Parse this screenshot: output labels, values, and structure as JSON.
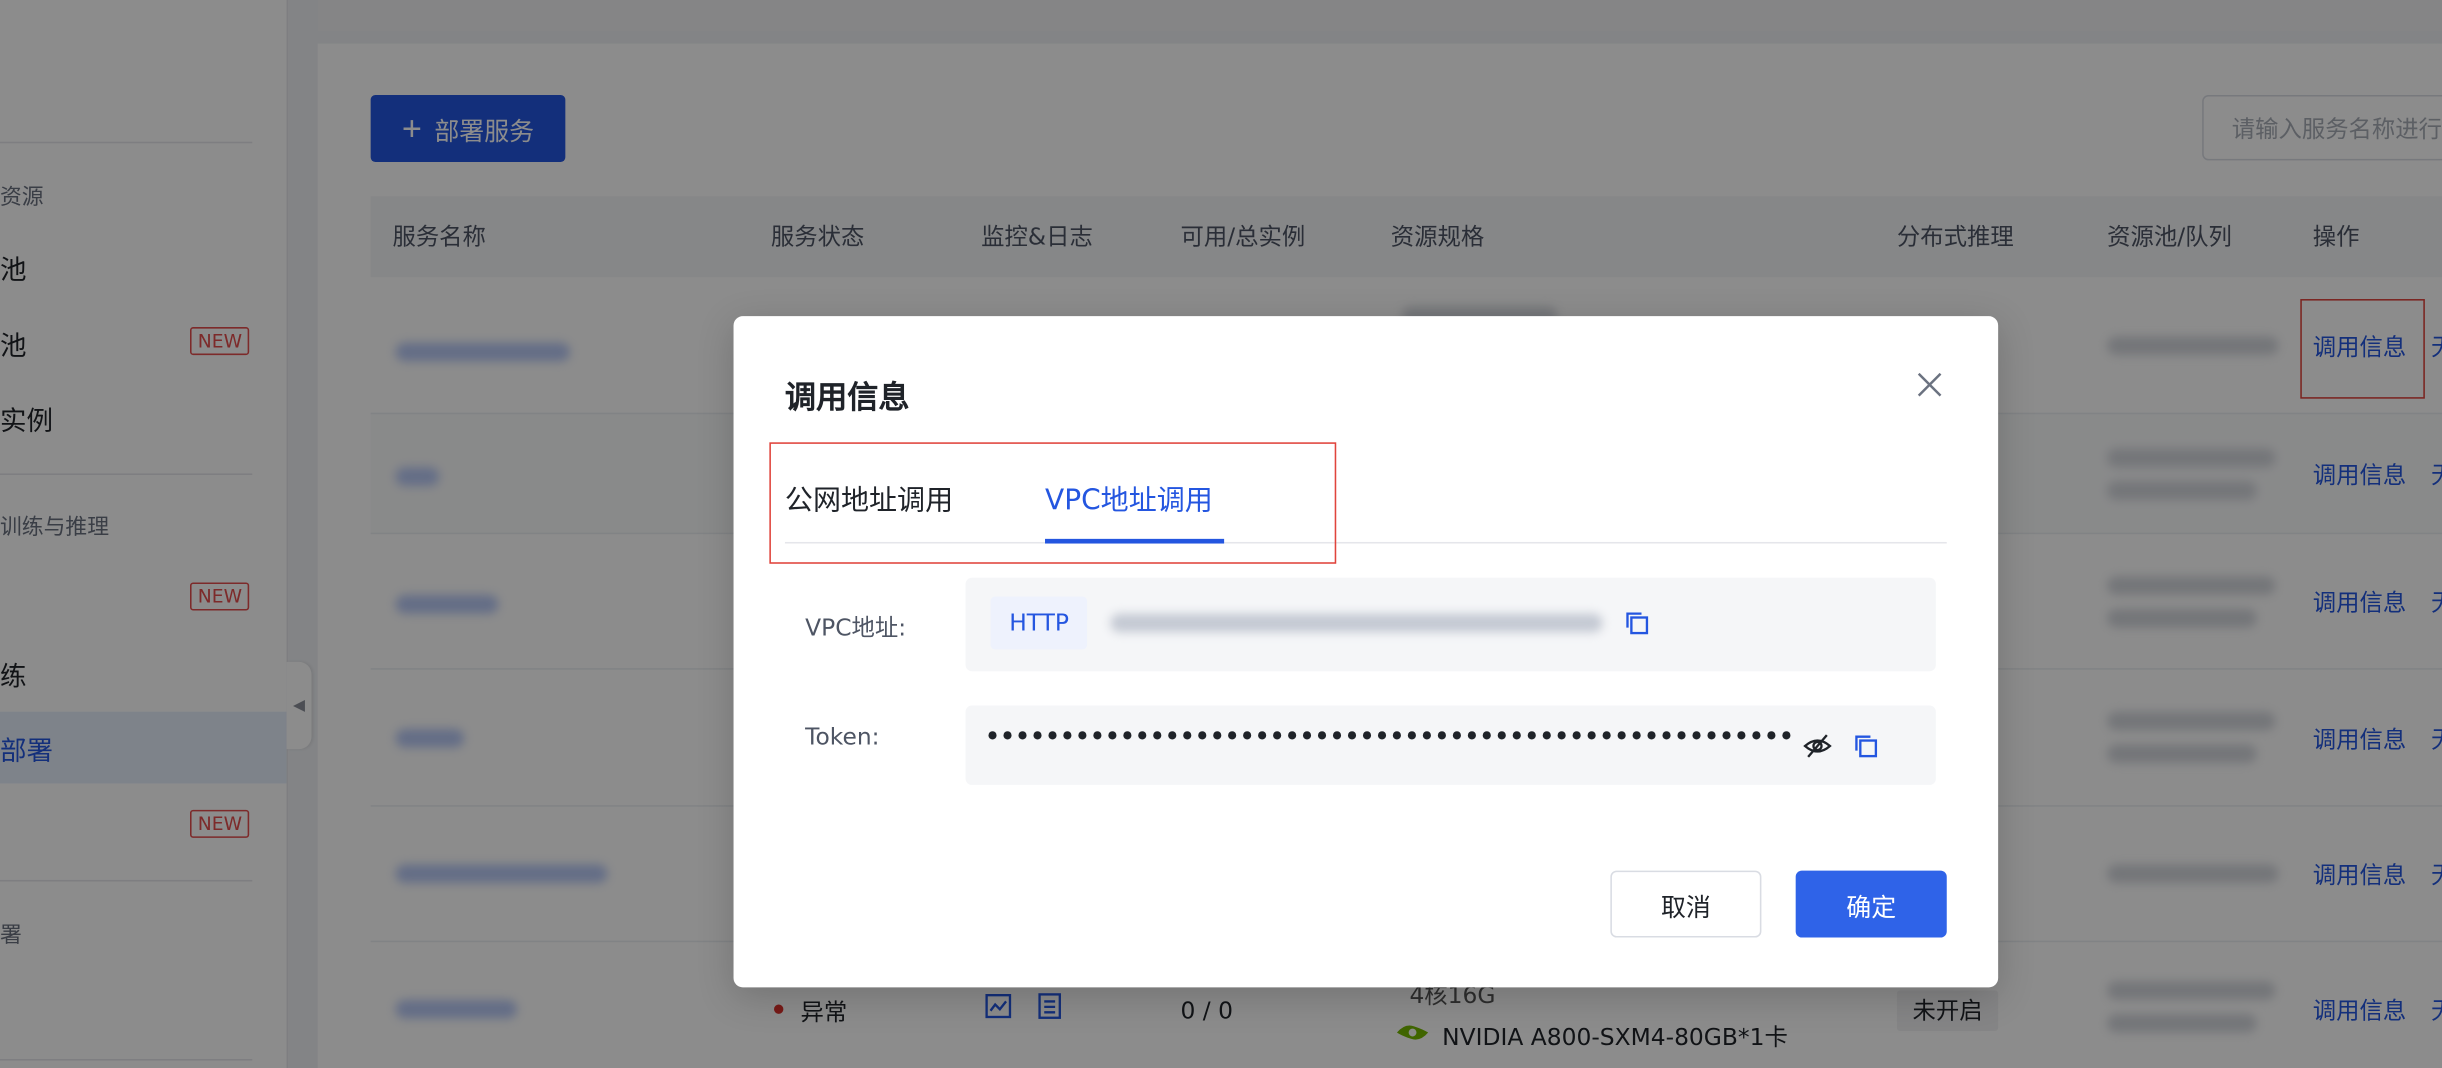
{
  "sidebar": {
    "groups": [
      "资源",
      "训练与推理",
      "署"
    ],
    "items": [
      "池",
      "池",
      "实例",
      "练",
      "部署"
    ],
    "new_badge": "NEW"
  },
  "toolbar": {
    "deploy_label": "部署服务",
    "search_placeholder": "请输入服务名称进行"
  },
  "table": {
    "columns": [
      "服务名称",
      "服务状态",
      "监控&日志",
      "可用/总实例",
      "资源规格",
      "分布式推理",
      "资源池/队列",
      "操作"
    ],
    "op_link": "调用信息",
    "op_more": "无",
    "last_row": {
      "status": "异常",
      "instances": "0 / 0",
      "spec_cpu": "4核16G",
      "spec_gpu": "NVIDIA A800-SXM4-80GB*1卡",
      "distributed": "未开启"
    }
  },
  "modal": {
    "title": "调用信息",
    "tabs": [
      "公网地址调用",
      "VPC地址调用"
    ],
    "active_tab": "VPC地址调用",
    "vpc_label": "VPC地址:",
    "protocol": "HTTP",
    "token_label": "Token:",
    "token_mask": "•••••••••••••••••••••••••••••••••••••••••••••••••••••••••••••••••••",
    "cancel": "取消",
    "ok": "确定"
  },
  "colors": {
    "primary": "#2456e0",
    "highlight": "#e0443c",
    "error": "#d9312b"
  },
  "icons": [
    "plus-icon",
    "close-icon",
    "copy-icon",
    "eye-off-icon",
    "monitor-icon",
    "log-icon",
    "gpu-icon",
    "chevron-left-icon"
  ]
}
